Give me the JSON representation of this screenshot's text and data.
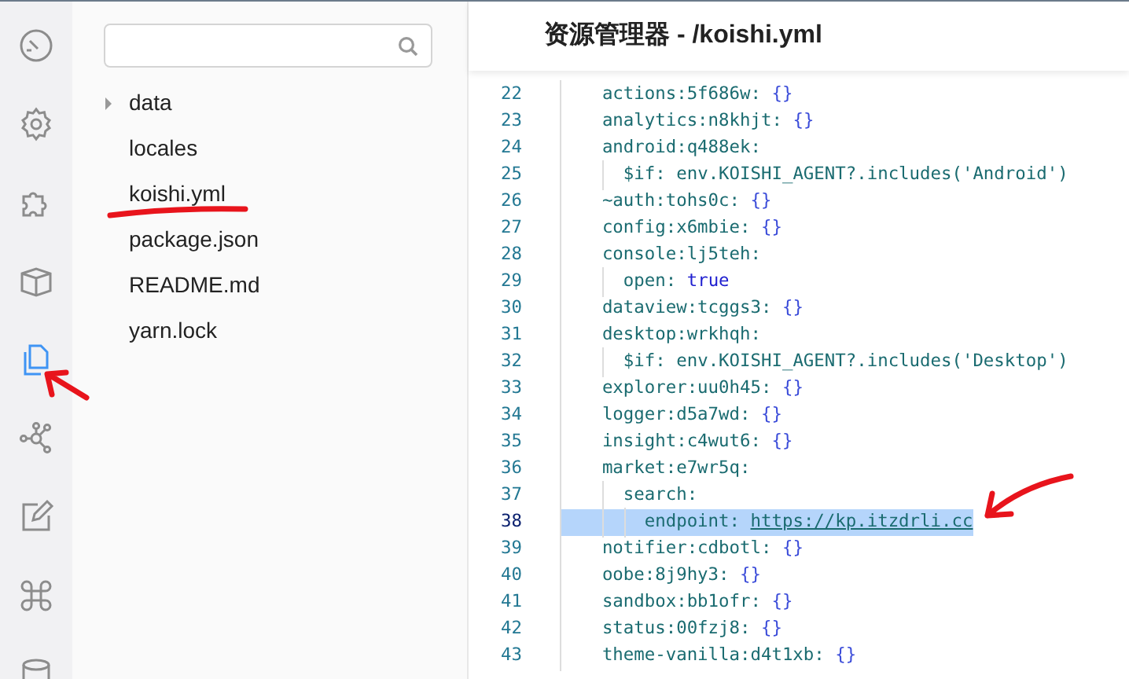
{
  "activity_bar": {
    "icons": [
      {
        "kind": "dashboard",
        "selected": false
      },
      {
        "kind": "gear",
        "selected": false
      },
      {
        "kind": "puzzle",
        "selected": false
      },
      {
        "kind": "box",
        "selected": false
      },
      {
        "kind": "files",
        "selected": true
      },
      {
        "kind": "network",
        "selected": false
      },
      {
        "kind": "edit",
        "selected": false
      },
      {
        "kind": "command",
        "selected": false
      },
      {
        "kind": "database",
        "selected": false
      }
    ]
  },
  "explorer": {
    "files": [
      {
        "name": "data",
        "kind": "folder",
        "expanded": false
      },
      {
        "name": "locales",
        "kind": "file"
      },
      {
        "name": "koishi.yml",
        "kind": "file"
      },
      {
        "name": "package.json",
        "kind": "file"
      },
      {
        "name": "README.md",
        "kind": "file"
      },
      {
        "name": "yarn.lock",
        "kind": "file"
      }
    ]
  },
  "editor": {
    "title": "资源管理器 - /koishi.yml",
    "lines": [
      {
        "number": "22",
        "text": "    actions:5f686w:",
        "value": "{}",
        "kind": "object",
        "selected": false
      },
      {
        "number": "23",
        "text": "    analytics:n8khjt:",
        "value": "{}",
        "kind": "object",
        "selected": false
      },
      {
        "number": "24",
        "text": "    android:q488ek:",
        "selected": false
      },
      {
        "number": "25",
        "text": "      $if:",
        "value": "env.KOISHI_AGENT?.includes('Android')",
        "kind": "string",
        "selected": false
      },
      {
        "number": "26",
        "text": "    ~auth:tohs0c:",
        "value": "{}",
        "kind": "object",
        "selected": false
      },
      {
        "number": "27",
        "text": "    config:x6mbie:",
        "value": "{}",
        "kind": "object",
        "selected": false
      },
      {
        "number": "28",
        "text": "    console:lj5teh:",
        "selected": false
      },
      {
        "number": "29",
        "text": "      open:",
        "value": "true",
        "kind": "boolean",
        "selected": false
      },
      {
        "number": "30",
        "text": "    dataview:tcggs3:",
        "value": "{}",
        "kind": "object",
        "selected": false
      },
      {
        "number": "31",
        "text": "    desktop:wrkhqh:",
        "selected": false
      },
      {
        "number": "32",
        "text": "      $if:",
        "value": "env.KOISHI_AGENT?.includes('Desktop')",
        "kind": "string",
        "selected": false
      },
      {
        "number": "33",
        "text": "    explorer:uu0h45:",
        "value": "{}",
        "kind": "object",
        "selected": false
      },
      {
        "number": "34",
        "text": "    logger:d5a7wd:",
        "value": "{}",
        "kind": "object",
        "selected": false
      },
      {
        "number": "35",
        "text": "    insight:c4wut6:",
        "value": "{}",
        "kind": "object",
        "selected": false
      },
      {
        "number": "36",
        "text": "    market:e7wr5q:",
        "selected": false
      },
      {
        "number": "37",
        "text": "      search:",
        "selected": false
      },
      {
        "number": "38",
        "text": "        endpoint:",
        "value": "https://kp.itzdrli.cc",
        "kind": "url",
        "selected": true
      },
      {
        "number": "39",
        "text": "    notifier:cdbotl:",
        "value": "{}",
        "kind": "object",
        "selected": false
      },
      {
        "number": "40",
        "text": "    oobe:8j9hy3:",
        "value": "{}",
        "kind": "object",
        "selected": false
      },
      {
        "number": "41",
        "text": "    sandbox:bb1ofr:",
        "value": "{}",
        "kind": "object",
        "selected": false
      },
      {
        "number": "42",
        "text": "    status:00fzj8:",
        "value": "{}",
        "kind": "object",
        "selected": false
      },
      {
        "number": "43",
        "text": "    theme-vanilla:d4t1xb:",
        "value": "{}",
        "kind": "object",
        "selected": false
      }
    ]
  },
  "annotations": [
    {
      "kind": "underline"
    },
    {
      "kind": "arrow_left"
    },
    {
      "kind": "arrow_right"
    }
  ]
}
